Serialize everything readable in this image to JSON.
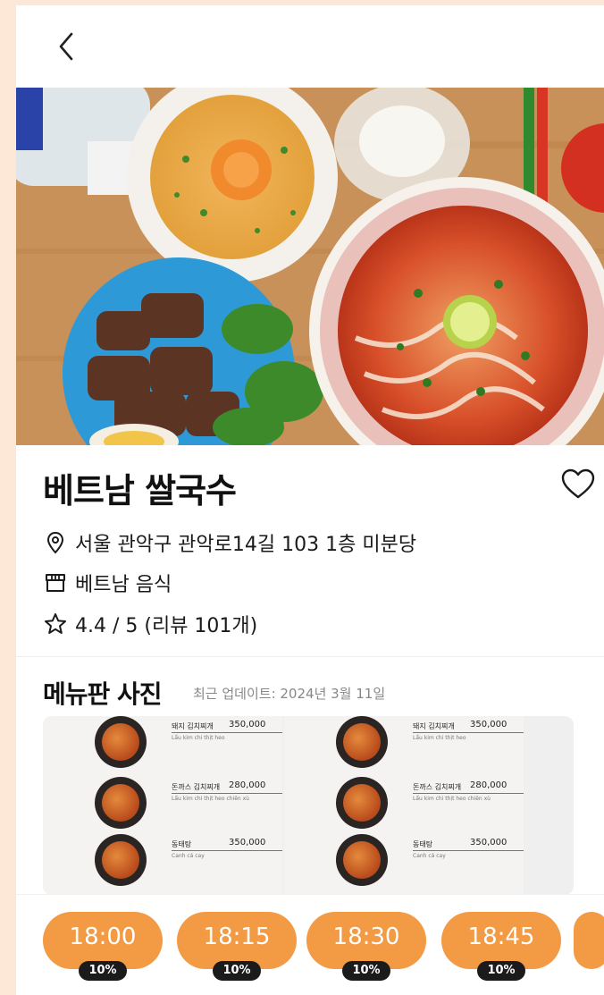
{
  "nav": {
    "back_icon": "chevron-left-icon"
  },
  "restaurant": {
    "name": "베트남 쌀국수",
    "address": "서울 관악구 관악로14길 103 1층 미분당",
    "category": "베트남 음식",
    "rating_text": "4.4 / 5 (리뷰 101개)",
    "rating": 4.4,
    "rating_max": 5,
    "review_count": 101
  },
  "menu_board": {
    "title": "메뉴판 사진",
    "updated": "최근 업데이트: 2024년 3월 11일",
    "items": [
      {
        "name": "돼지 김치찌개",
        "price": "350,000",
        "sub": "Lẩu kim chi thịt heo"
      },
      {
        "name": "돈까스 김치찌개",
        "price": "280,000",
        "sub": "Lẩu kim chi thịt heo chiên xù"
      },
      {
        "name": "동태탕",
        "price": "350,000",
        "sub": "Canh cá cay"
      }
    ]
  },
  "time_slots": [
    {
      "time": "18:00",
      "discount": "10%"
    },
    {
      "time": "18:15",
      "discount": "10%"
    },
    {
      "time": "18:30",
      "discount": "10%"
    },
    {
      "time": "18:45",
      "discount": "10%"
    }
  ],
  "colors": {
    "accent": "#f39a45",
    "badge": "#1b1b1b",
    "page_bg": "#fde7d6"
  }
}
